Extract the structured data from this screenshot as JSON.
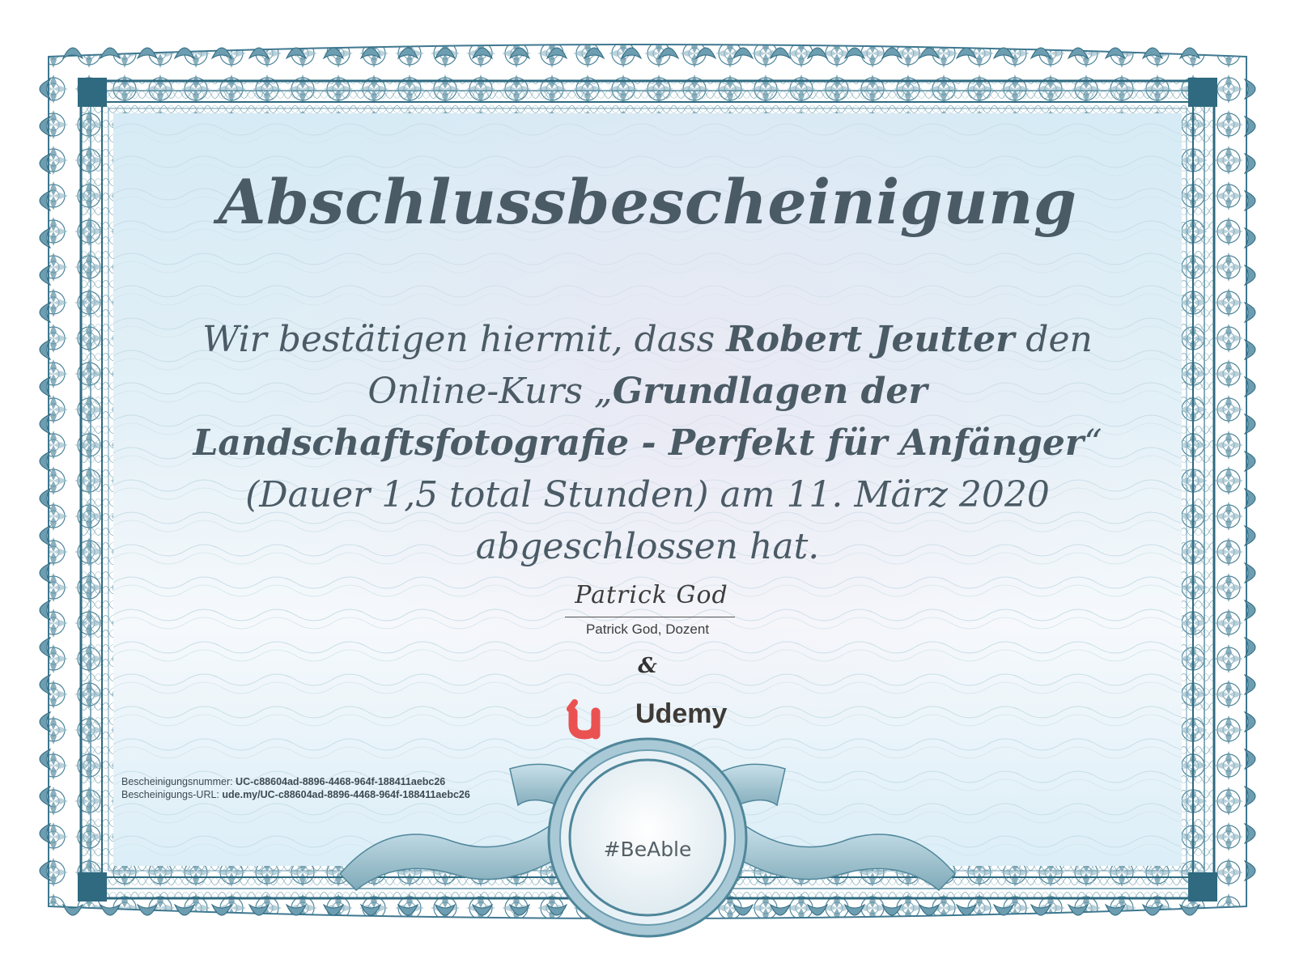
{
  "certificate": {
    "title": "Abschlussbescheinigung",
    "statement": {
      "intro": "Wir bestätigen hiermit, dass ",
      "recipient": "Robert Jeutter",
      "mid": " den Online-Kurs „",
      "course": "Grundlagen der Landschaftsfotografie - Perfekt für Anfänger",
      "close_quote": "“",
      "details": " (Dauer 1,5 total Stunden) am 11. März 2020 abgeschlossen hat."
    },
    "signature": {
      "script": "Patrick God",
      "caption": "Patrick God, Dozent"
    },
    "ampersand": "&",
    "brand": {
      "name": "Udemy",
      "mark_color": "#ea5252"
    },
    "meta": {
      "number_label": "Bescheinigungsnummer: ",
      "number_value": "UC-c88604ad-8896-4468-964f-188411aebc26",
      "url_label": "Bescheinigungs-URL: ",
      "url_value": "ude.my/UC-c88604ad-8896-4468-964f-188411aebc26"
    },
    "seal_text": "#BeAble"
  },
  "colors": {
    "frame": "#5b8fa3",
    "frame_dark": "#2f6a80",
    "text": "#4b5b66"
  }
}
